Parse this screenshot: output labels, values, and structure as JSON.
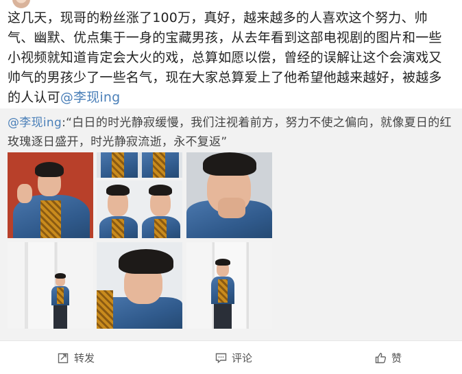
{
  "post": {
    "text_main": "这几天，现哥的粉丝涨了100万，真好，越来越多的人喜欢这个努力、帅气、幽默、优点集于一身的宝藏男孩，从去年看到这部电视剧的图片和一些小视频就知道肯定会大火的戏，总算如愿以偿，曾经的误解让这个会演戏又帅气的男孩少了一些名气，现在大家总算爱上了他希望他越来越好，被越多的人认可",
    "mention": "@李现ing"
  },
  "repost": {
    "author": "@李现ing",
    "text": ":“白日的时光静寂缓慢，我们注视着前方，努力不使之偏向，就像夏日的红玫瑰逐日盛开，时光静寂流逝，永不复返”"
  },
  "actions": {
    "forward_label": "转发",
    "comment_label": "评论",
    "like_label": "赞"
  },
  "colors": {
    "link": "#4a7fb8",
    "repost_bg": "#f2f2f2",
    "text": "#222222"
  }
}
